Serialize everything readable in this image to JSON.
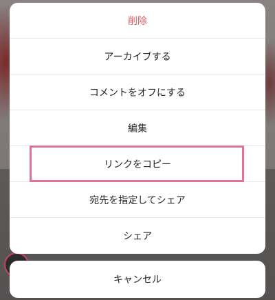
{
  "action_sheet": {
    "items": [
      {
        "label": "削除"
      },
      {
        "label": "アーカイブする"
      },
      {
        "label": "コメントをオフにする"
      },
      {
        "label": "編集"
      },
      {
        "label": "リンクをコピー"
      },
      {
        "label": "宛先を指定してシェア"
      },
      {
        "label": "シェア"
      }
    ],
    "cancel_label": "キャンセル"
  },
  "colors": {
    "danger": "#e35b5b",
    "highlight": "#e46f9b"
  }
}
